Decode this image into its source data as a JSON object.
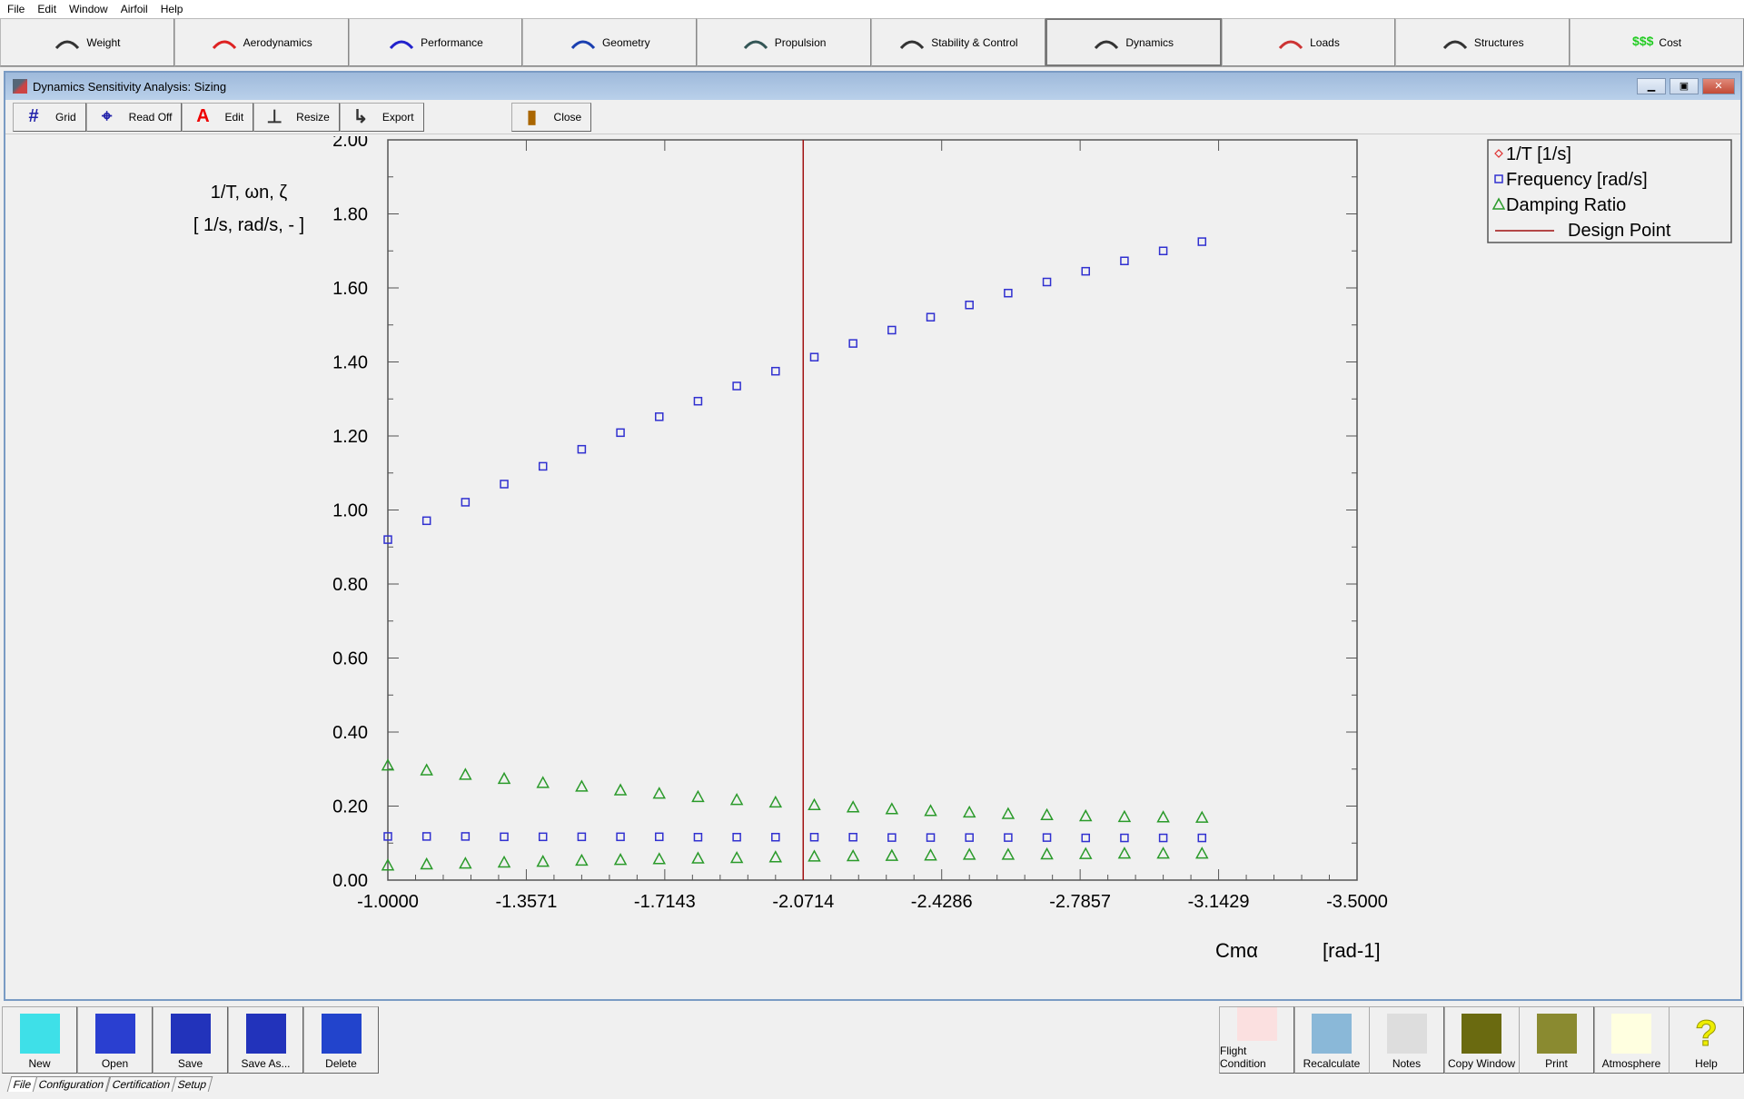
{
  "menu": [
    "File",
    "Edit",
    "Window",
    "Airfoil",
    "Help"
  ],
  "modules": [
    {
      "label": "Weight",
      "icon": "balance-scale-icon"
    },
    {
      "label": "Aerodynamics",
      "icon": "airflow-icon"
    },
    {
      "label": "Performance",
      "icon": "range-icon"
    },
    {
      "label": "Geometry",
      "icon": "wing-geometry-icon"
    },
    {
      "label": "Propulsion",
      "icon": "propeller-icon"
    },
    {
      "label": "Stability & Control",
      "icon": "stability-icon"
    },
    {
      "label": "Dynamics",
      "icon": "dynamics-icon",
      "active": true
    },
    {
      "label": "Loads",
      "icon": "loads-icon"
    },
    {
      "label": "Structures",
      "icon": "truss-icon"
    },
    {
      "label": "Cost",
      "icon": "dollar-icon",
      "icon_text": "$$$"
    }
  ],
  "window": {
    "title": "Dynamics Sensitivity Analysis: Sizing",
    "controls": [
      "minimize",
      "restore",
      "close"
    ]
  },
  "toolbar": [
    {
      "label": "Grid",
      "icon": "grid-icon"
    },
    {
      "label": "Read Off",
      "icon": "read-off-icon"
    },
    {
      "label": "Edit",
      "icon": "text-edit-icon"
    },
    {
      "label": "Resize",
      "icon": "resize-icon"
    },
    {
      "label": "Export",
      "icon": "export-icon"
    },
    {
      "label": "Close",
      "icon": "door-icon"
    }
  ],
  "chart_data": {
    "type": "scatter",
    "ylabel_line1": "1/T, ωn, ζ",
    "ylabel_line2": "[ 1/s, rad/s, - ]",
    "xlabel": "Cmα",
    "xunit": "[rad-1]",
    "xlim": [
      -1.0,
      -3.5
    ],
    "ylim": [
      0,
      2
    ],
    "xticks": [
      "-1.0000",
      "-1.3571",
      "-1.7143",
      "-2.0714",
      "-2.4286",
      "-2.7857",
      "-3.1429",
      "-3.5000"
    ],
    "yticks": [
      "0.00",
      "0.20",
      "0.40",
      "0.60",
      "0.80",
      "1.00",
      "1.20",
      "1.40",
      "1.60",
      "1.80",
      "2.00"
    ],
    "grid": false,
    "legend_position": "top-right",
    "legend": [
      {
        "label": "1/T [1/s]",
        "marker": "diamond",
        "color": "#e03030"
      },
      {
        "label": "Frequency [rad/s]",
        "marker": "square",
        "color": "#3030d0"
      },
      {
        "label": "Damping Ratio",
        "marker": "triangle",
        "color": "#2a9a2a"
      },
      {
        "label": "Design Point",
        "marker": "line",
        "color": "#a01010"
      }
    ],
    "design_point_x": -2.0714,
    "x": [
      -1.0,
      -1.1,
      -1.2,
      -1.3,
      -1.4,
      -1.5,
      -1.6,
      -1.7,
      -1.8,
      -1.9,
      -2.0,
      -2.1,
      -2.2,
      -2.3,
      -2.4,
      -2.5,
      -2.6,
      -2.7,
      -2.8,
      -2.9,
      -3.0,
      -3.1
    ],
    "series": [
      {
        "name": "Frequency [rad/s]",
        "marker": "square",
        "color": "#3030d0",
        "values": [
          0.92,
          0.971,
          1.021,
          1.07,
          1.118,
          1.164,
          1.209,
          1.252,
          1.294,
          1.335,
          1.375,
          1.413,
          1.45,
          1.486,
          1.521,
          1.554,
          1.586,
          1.616,
          1.645,
          1.673,
          1.7,
          1.725
        ]
      },
      {
        "name": "Frequency [rad/s]",
        "marker": "square",
        "color": "#3030d0",
        "values": [
          0.118,
          0.118,
          0.118,
          0.117,
          0.117,
          0.117,
          0.117,
          0.117,
          0.116,
          0.116,
          0.116,
          0.116,
          0.116,
          0.115,
          0.115,
          0.115,
          0.115,
          0.115,
          0.114,
          0.114,
          0.114,
          0.114
        ]
      },
      {
        "name": "Damping Ratio",
        "marker": "triangle",
        "color": "#2a9a2a",
        "values": [
          0.31,
          0.297,
          0.285,
          0.274,
          0.263,
          0.253,
          0.243,
          0.234,
          0.225,
          0.217,
          0.21,
          0.203,
          0.197,
          0.192,
          0.187,
          0.183,
          0.179,
          0.176,
          0.173,
          0.171,
          0.17,
          0.169
        ]
      },
      {
        "name": "Damping Ratio",
        "marker": "triangle",
        "color": "#2a9a2a",
        "values": [
          0.04,
          0.043,
          0.045,
          0.048,
          0.05,
          0.053,
          0.055,
          0.057,
          0.059,
          0.06,
          0.062,
          0.064,
          0.065,
          0.066,
          0.067,
          0.069,
          0.069,
          0.07,
          0.071,
          0.072,
          0.072,
          0.072
        ]
      }
    ]
  },
  "bottom_left": [
    {
      "label": "New",
      "icon": "new-file-icon"
    },
    {
      "label": "Open",
      "icon": "open-hangar-icon"
    },
    {
      "label": "Save",
      "icon": "floppy-save-icon"
    },
    {
      "label": "Save As...",
      "icon": "floppy-save-as-icon"
    },
    {
      "label": "Delete",
      "icon": "trash-bin-icon"
    }
  ],
  "bottom_right": [
    {
      "label": "Flight Condition",
      "icon": "flight-profile-icon"
    },
    {
      "label": "Recalculate",
      "icon": "calculator-icon"
    },
    {
      "label": "Notes",
      "icon": "notepad-icon"
    },
    {
      "label": "Copy Window",
      "icon": "copy-window-icon"
    },
    {
      "label": "Print",
      "icon": "printer-icon"
    },
    {
      "label": "Atmosphere",
      "icon": "sun-cloud-icon"
    },
    {
      "label": "Help",
      "icon": "question-mark-icon",
      "icon_text": "?"
    }
  ],
  "sheet_tabs": [
    {
      "label": "File",
      "active": true
    },
    {
      "label": "Configuration"
    },
    {
      "label": "Certification"
    },
    {
      "label": "Setup"
    }
  ]
}
